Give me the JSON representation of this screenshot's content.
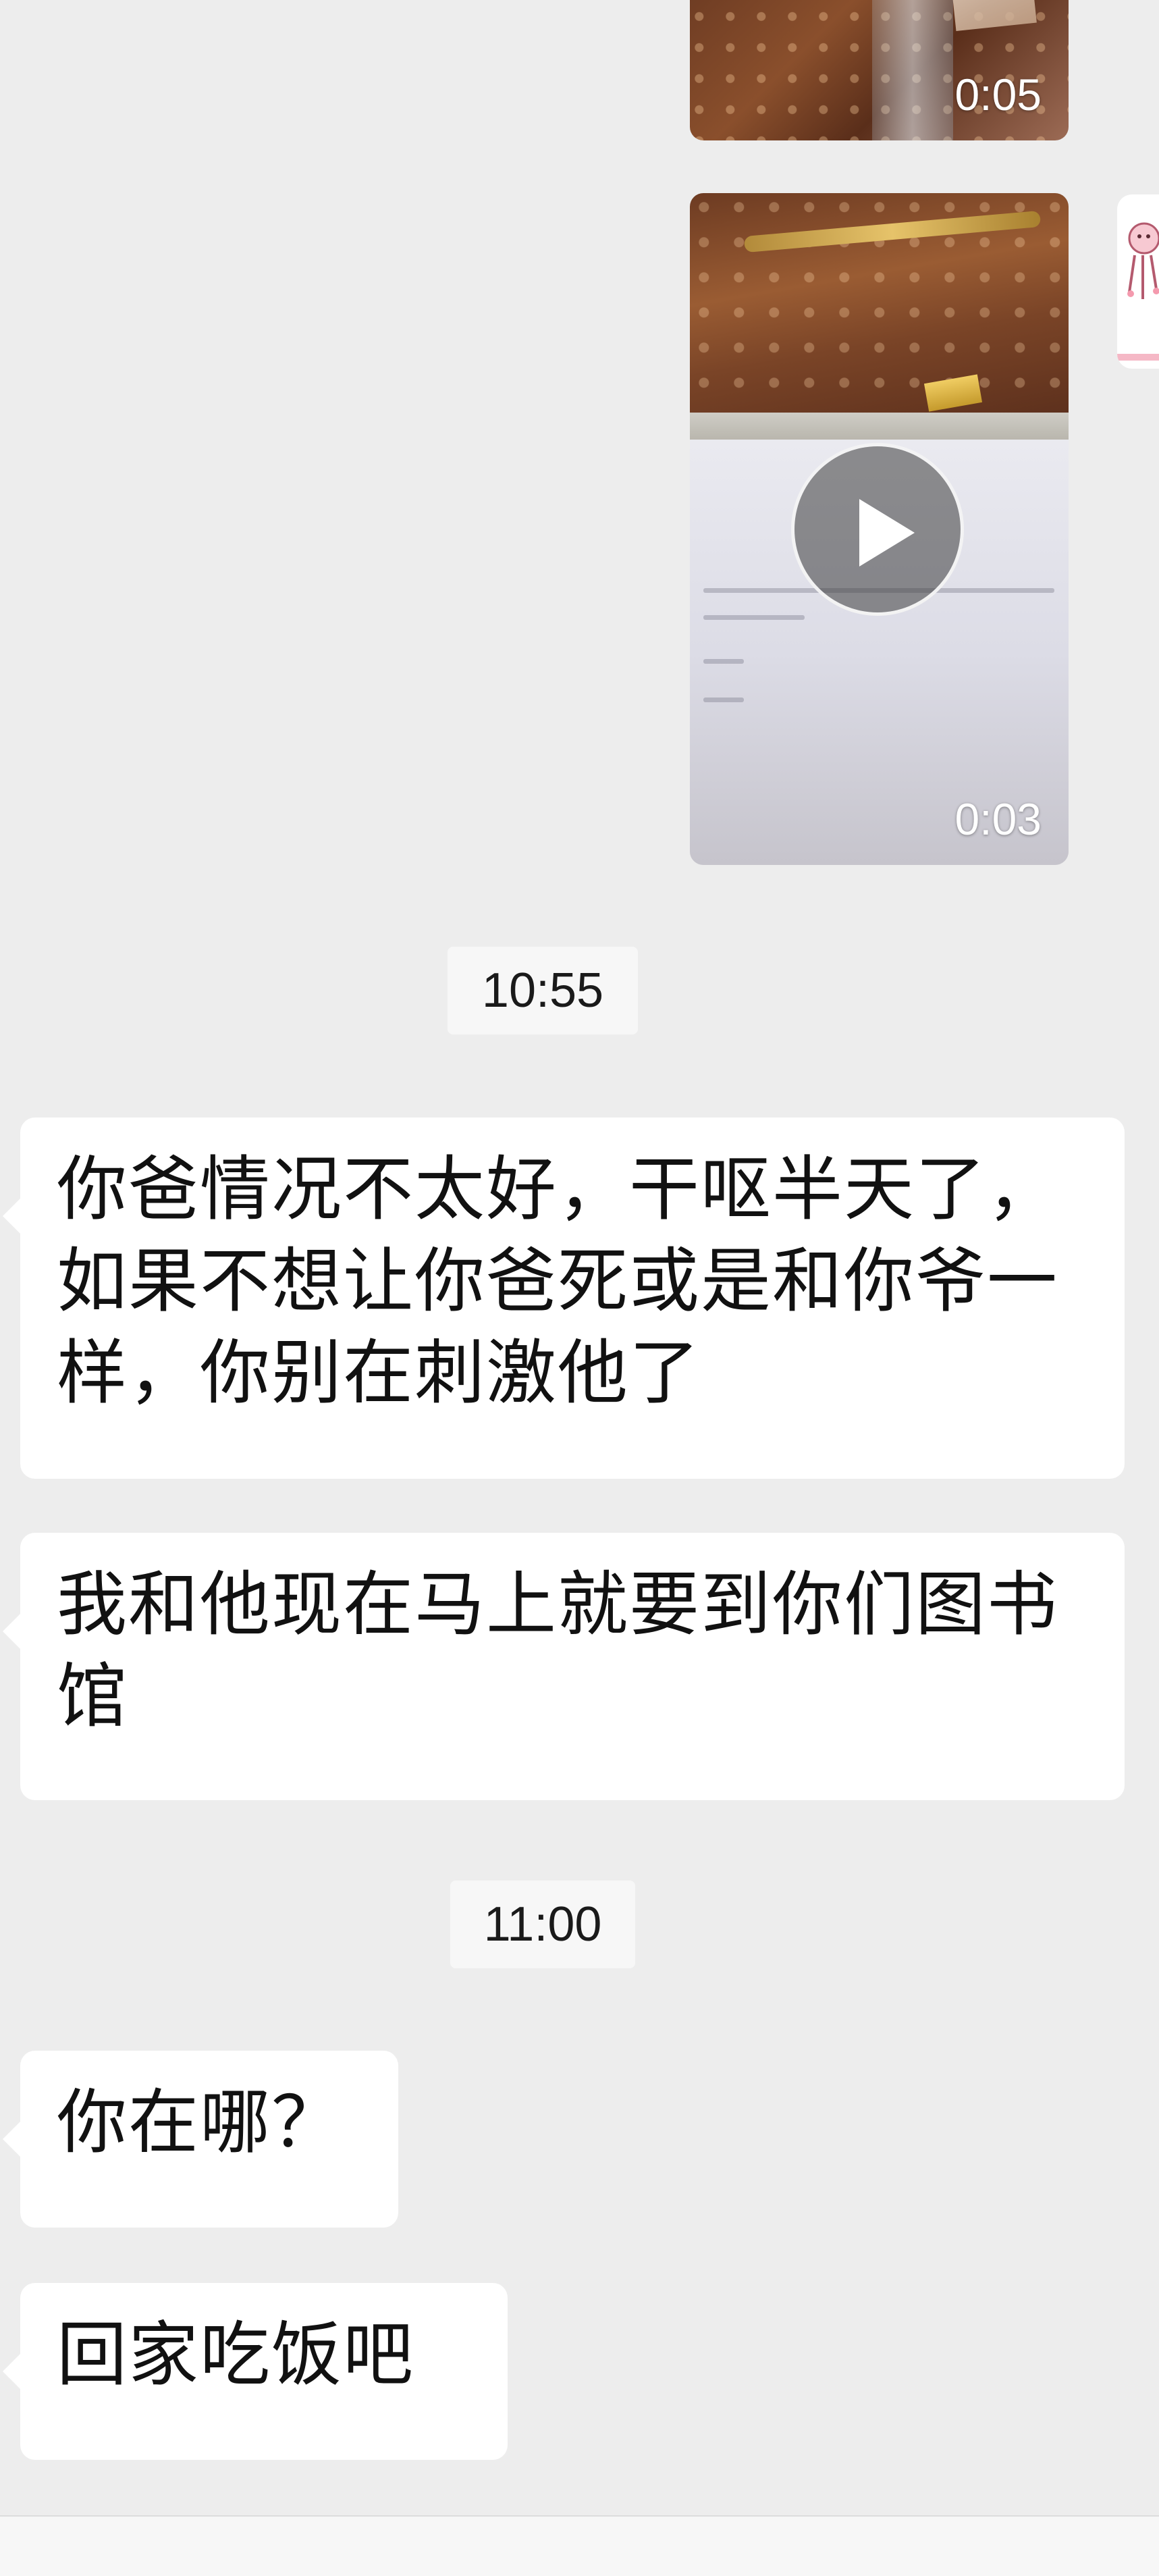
{
  "chat": {
    "messages": [
      {
        "type": "video",
        "direction": "outgoing",
        "duration": "0:05"
      },
      {
        "type": "video",
        "direction": "outgoing",
        "duration": "0:03"
      },
      {
        "type": "timestamp",
        "text": "10:55"
      },
      {
        "type": "text",
        "direction": "incoming",
        "text": "你爸情况不太好，干呕半天了，如果不想让你爸死或是和你爷一样，你别在刺激他了"
      },
      {
        "type": "text",
        "direction": "incoming",
        "text": "我和他现在马上就要到你们图书馆"
      },
      {
        "type": "timestamp",
        "text": "11:00"
      },
      {
        "type": "text",
        "direction": "incoming",
        "text": "你在哪？"
      },
      {
        "type": "text",
        "direction": "incoming",
        "text": "回家吃饭吧"
      }
    ]
  },
  "icons": {
    "play": "play-icon"
  },
  "colors": {
    "background": "#ededed",
    "bubble_incoming": "#ffffff",
    "timestamp_bg": "#f7f7f7",
    "text": "#111111"
  }
}
